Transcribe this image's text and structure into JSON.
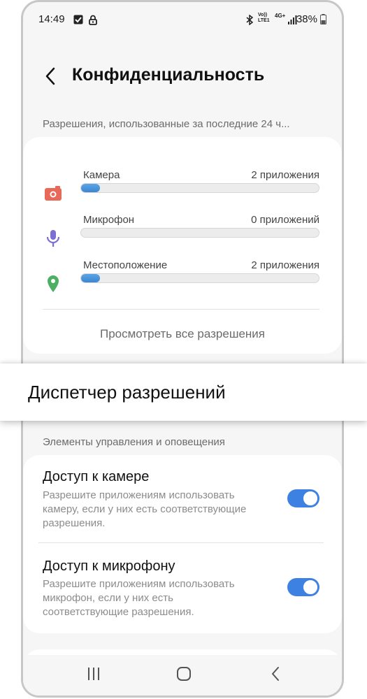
{
  "status_bar": {
    "time": "14:49",
    "left_icons": [
      "checkbox-icon",
      "lock-icon"
    ],
    "right_icons": [
      "bluetooth-icon",
      "volte-icon",
      "network-4g-icon",
      "signal-icon"
    ],
    "volte_label": "Vo)) LTE1",
    "net_label": "4G+",
    "battery": "38%"
  },
  "header": {
    "title": "Конфиденциальность"
  },
  "permissions_section": {
    "label": "Разрешения, использованные за последние 24 ч...",
    "items": [
      {
        "name": "Камера",
        "count": "2 приложения",
        "icon": "camera-icon",
        "color": "#e8685a",
        "usage_fraction": 0.08
      },
      {
        "name": "Микрофон",
        "count": "0 приложений",
        "icon": "microphone-icon",
        "color": "#7b6fd6",
        "usage_fraction": 0
      },
      {
        "name": "Местоположение",
        "count": "2 приложения",
        "icon": "location-pin-icon",
        "color": "#4caf63",
        "usage_fraction": 0.08
      }
    ],
    "view_all_label": "Просмотреть все разрешения"
  },
  "highlight": {
    "label": "Диспетчер разрешений"
  },
  "controls_section": {
    "label": "Элементы управления и оповещения",
    "items": [
      {
        "title": "Доступ к камере",
        "description": "Разрешите приложениям использовать камеру, если у них есть соответствующие разрешения.",
        "enabled": true
      },
      {
        "title": "Доступ к микрофону",
        "description": "Разрешите приложениям использовать микрофон, если у них есть соответствующие разрешения.",
        "enabled": true
      }
    ]
  },
  "nav_bar": {
    "icons": [
      "recent-apps-icon",
      "home-icon",
      "back-nav-icon"
    ]
  },
  "colors": {
    "accent": "#3d82e2",
    "background": "#f6f6f6",
    "card": "#ffffff"
  }
}
